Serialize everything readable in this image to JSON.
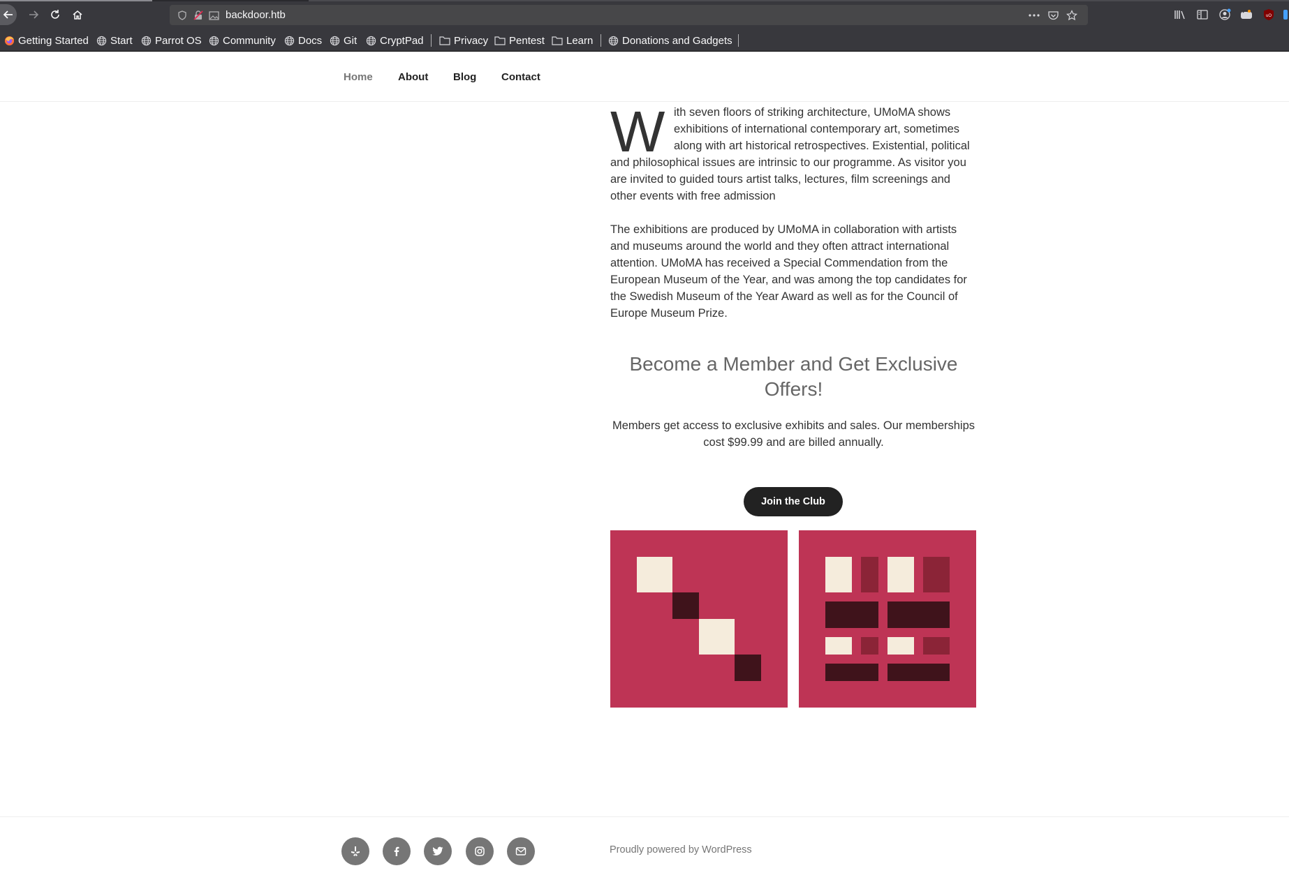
{
  "browser": {
    "url": "backdoor.htb",
    "bookmarks": [
      {
        "label": "Getting Started",
        "icon": "firefox-icon"
      },
      {
        "label": "Start",
        "icon": "globe-icon"
      },
      {
        "label": "Parrot OS",
        "icon": "globe-icon"
      },
      {
        "label": "Community",
        "icon": "globe-icon"
      },
      {
        "label": "Docs",
        "icon": "globe-icon"
      },
      {
        "label": "Git",
        "icon": "globe-icon"
      },
      {
        "label": "CryptPad",
        "icon": "globe-icon"
      },
      {
        "label": "Privacy",
        "icon": "folder-icon"
      },
      {
        "label": "Pentest",
        "icon": "folder-icon"
      },
      {
        "label": "Learn",
        "icon": "folder-icon"
      },
      {
        "label": "Donations and Gadgets",
        "icon": "globe-icon"
      }
    ]
  },
  "nav": {
    "items": [
      {
        "label": "Home",
        "current": true
      },
      {
        "label": "About",
        "current": false
      },
      {
        "label": "Blog",
        "current": false
      },
      {
        "label": "Contact",
        "current": false
      }
    ]
  },
  "content": {
    "dropcap": "W",
    "p1_first": "ith seven floors of striking architecture, UMoMA shows exhibitions of international contemporary art, sometimes along with art historical retrospectives. Existential, political",
    "p1_rest": "and philosophical issues are intrinsic to our programme. As visitor you are invited to guided tours artist talks, lectures, film screenings and other events with free admission",
    "p2": "The exhibitions are produced by UMoMA in collaboration with artists and museums around the world and they often attract international attention. UMoMA has received a Special Commendation from the European Museum of the Year, and was among the top candidates for the Swedish Museum of the Year Award as well as for the Council of Europe Museum Prize.",
    "member_heading": "Become a Member and Get Exclusive Offers!",
    "member_text": "Members get access to exclusive exhibits and sales. Our memberships cost $99.99 and are billed annually.",
    "join_button": "Join the Club"
  },
  "colors": {
    "art_background": "#be3455",
    "cream": "#f5ecdc",
    "dark": "#3f131b",
    "mid": "#8b2437"
  },
  "footer": {
    "social_icons": [
      "yelp-icon",
      "facebook-icon",
      "twitter-icon",
      "instagram-icon",
      "email-icon"
    ],
    "powered_by": "Proudly powered by WordPress"
  }
}
